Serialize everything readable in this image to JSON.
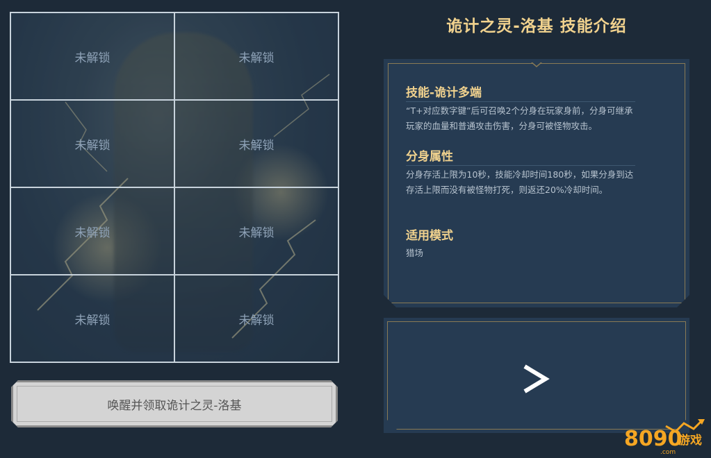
{
  "skill_page": {
    "title": "诡计之灵-洛基 技能介绍",
    "grid_cells": [
      "未解锁",
      "未解锁",
      "未解锁",
      "未解锁",
      "未解锁",
      "未解锁",
      "未解锁",
      "未解锁"
    ],
    "awaken_button": "唤醒并领取诡计之灵-洛基",
    "sections": [
      {
        "heading": "技能-诡计多端",
        "text": "“T+对应数字键”后可召唤2个分身在玩家身前，分身可继承玩家的血量和普通攻击伤害，分身可被怪物攻击。"
      },
      {
        "heading": "分身属性",
        "text": "分身存活上限为10秒，技能冷却时间180秒，如果分身到达存活上限而没有被怪物打死，则返还20%冷却时间。"
      },
      {
        "heading": "适用模式",
        "text": "猎场"
      }
    ],
    "next_icon": "next-arrow-icon"
  },
  "watermark": {
    "brand_number": "8090",
    "brand_text": "游戏",
    "domain_suffix": ".com"
  },
  "colors": {
    "background": "#1d2a38",
    "panel": "#263b52",
    "gold_text": "#f1d28e",
    "border_gold": "#8a7b55",
    "logo_orange": "#f5a623"
  }
}
